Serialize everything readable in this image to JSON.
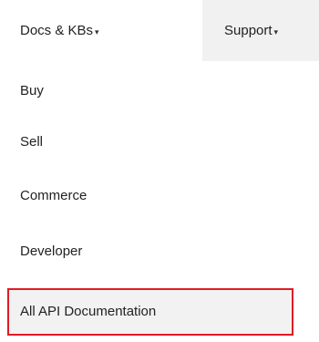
{
  "nav": {
    "docs_label": "Docs & KBs",
    "support_label": "Support",
    "caret_glyph": "▾"
  },
  "menu": {
    "items": [
      {
        "label": "Buy"
      },
      {
        "label": "Sell"
      },
      {
        "label": "Commerce"
      },
      {
        "label": "Developer"
      },
      {
        "label": "All API Documentation"
      }
    ]
  },
  "colors": {
    "highlight_border": "#e01b24",
    "highlight_bg": "#f2f2f2",
    "support_tab_bg": "#f1f1f1"
  }
}
